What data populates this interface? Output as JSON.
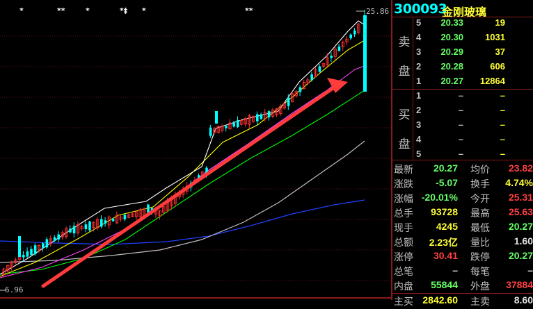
{
  "stock": {
    "code": "300093",
    "name": "金刚玻璃"
  },
  "chart": {
    "high_label": "25.86",
    "low_label": "6.96",
    "markers": [
      "*",
      "**",
      "*",
      "*‡",
      "*",
      "**"
    ]
  },
  "sell_label_1": "卖",
  "sell_label_2": "盘",
  "buy_label_1": "买",
  "buy_label_2": "盘",
  "sell_orders": [
    {
      "level": "5",
      "price": "20.33",
      "volume": "19"
    },
    {
      "level": "4",
      "price": "20.30",
      "volume": "1031"
    },
    {
      "level": "3",
      "price": "20.29",
      "volume": "37"
    },
    {
      "level": "2",
      "price": "20.28",
      "volume": "606"
    },
    {
      "level": "1",
      "price": "20.27",
      "volume": "12864"
    }
  ],
  "buy_orders": [
    {
      "level": "1",
      "price": "–",
      "volume": "–"
    },
    {
      "level": "2",
      "price": "–",
      "volume": "–"
    },
    {
      "level": "3",
      "price": "–",
      "volume": "–"
    },
    {
      "level": "4",
      "price": "–",
      "volume": "–"
    },
    {
      "level": "5",
      "price": "–",
      "volume": "–"
    }
  ],
  "stats": [
    {
      "l1": "最新",
      "v1": "20.27",
      "c1": "g",
      "l2": "均价",
      "v2": "23.82",
      "c2": "r"
    },
    {
      "l1": "涨跌",
      "v1": "-5.07",
      "c1": "g",
      "l2": "换手",
      "v2": "4.74%",
      "c2": "pct"
    },
    {
      "l1": "涨幅",
      "v1": "-20.01%",
      "c1": "g",
      "l2": "今开",
      "v2": "25.31",
      "c2": "r"
    },
    {
      "l1": "总手",
      "v1": "93728",
      "c1": "y",
      "l2": "最高",
      "v2": "25.63",
      "c2": "r"
    },
    {
      "l1": "现手",
      "v1": "4245",
      "c1": "y",
      "l2": "最低",
      "v2": "20.27",
      "c2": "g"
    },
    {
      "l1": "总额",
      "v1": "2.23亿",
      "c1": "y",
      "l2": "量比",
      "v2": "1.60",
      "c2": "w"
    },
    {
      "l1": "涨停",
      "v1": "30.41",
      "c1": "r",
      "l2": "跌停",
      "v2": "20.27",
      "c2": "g"
    },
    {
      "l1": "总笔",
      "v1": "–",
      "c1": "w",
      "l2": "每笔",
      "v2": "–",
      "c2": "w"
    },
    {
      "l1": "内盘",
      "v1": "55844",
      "c1": "g",
      "l2": "外盘",
      "v2": "37884",
      "c2": "r"
    }
  ],
  "footer": {
    "l1": "主买",
    "v1": "2842.60",
    "l2": "主卖",
    "v2": "8.60"
  },
  "colors": {
    "up": "#ff3030",
    "down": "#00ffff",
    "ma5": "#ffffff",
    "ma10": "#ffff00",
    "ma20": "#ff44ff",
    "ma30": "#00ff00",
    "ma60": "#c0c0c0",
    "ma120": "#2040ff",
    "arrow": "#ff3b3b"
  }
}
